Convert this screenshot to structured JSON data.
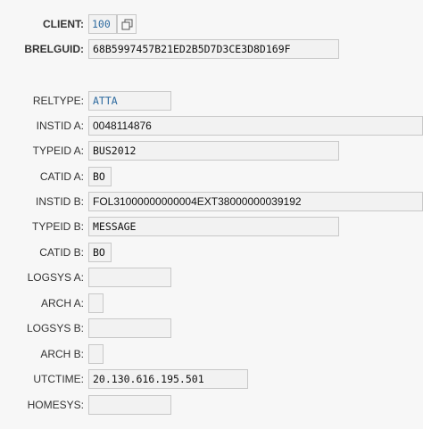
{
  "header": {
    "client_label": "CLIENT:",
    "client_value": "100",
    "brelguid_label": "BRELGUID:",
    "brelguid_value": "68B5997457B21ED2B5D7D3CE3D8D169F",
    "copy_icon": "copy-icon"
  },
  "fields": {
    "reltype": {
      "label": "RELTYPE:",
      "value": "ATTA"
    },
    "instid_a": {
      "label": "INSTID A:",
      "value": "0048114876"
    },
    "typeid_a": {
      "label": "TYPEID A:",
      "value": "BUS2012"
    },
    "catid_a": {
      "label": "CATID A:",
      "value": "BO"
    },
    "instid_b": {
      "label": "INSTID B:",
      "value": "FOL31000000000004EXT38000000039192"
    },
    "typeid_b": {
      "label": "TYPEID B:",
      "value": "MESSAGE"
    },
    "catid_b": {
      "label": "CATID B:",
      "value": "BO"
    },
    "logsys_a": {
      "label": "LOGSYS A:",
      "value": ""
    },
    "arch_a": {
      "label": "ARCH A:",
      "value": ""
    },
    "logsys_b": {
      "label": "LOGSYS B:",
      "value": ""
    },
    "arch_b": {
      "label": "ARCH B:",
      "value": ""
    },
    "utctime": {
      "label": "UTCTIME:",
      "value": "20.130.616.195.501"
    },
    "homesys": {
      "label": "HOMESYS:",
      "value": ""
    }
  }
}
